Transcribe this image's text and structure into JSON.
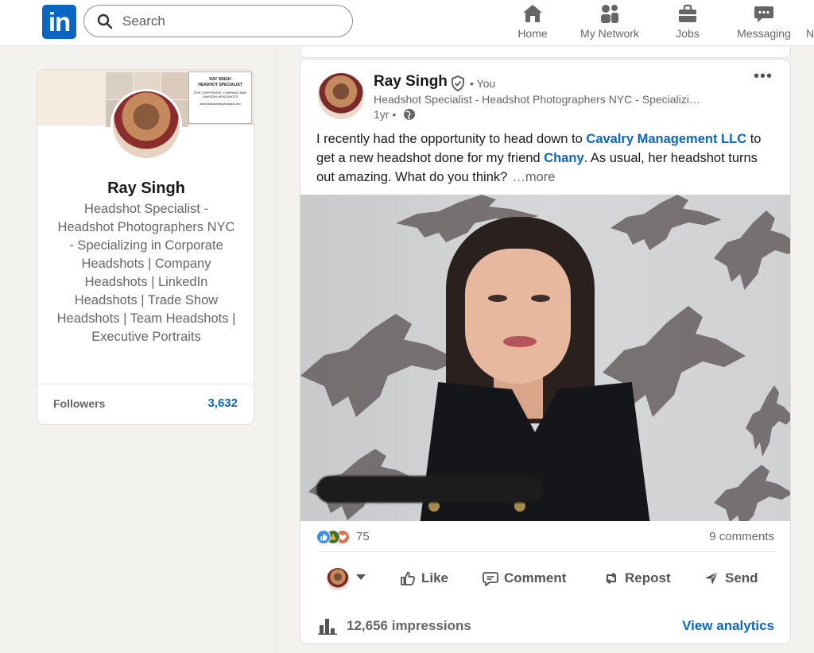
{
  "nav": {
    "logo": "in",
    "search_placeholder": "Search",
    "items": [
      {
        "label": "Home",
        "icon": "home-icon"
      },
      {
        "label": "My Network",
        "icon": "network-icon"
      },
      {
        "label": "Jobs",
        "icon": "briefcase-icon"
      },
      {
        "label": "Messaging",
        "icon": "messaging-icon"
      },
      {
        "label": "N",
        "icon": ""
      }
    ]
  },
  "profile": {
    "name": "Ray Singh",
    "headline": "Headshot Specialist - Headshot Photographers NYC - Specializing in Corporate Headshots | Company Headshots | LinkedIn Headshots | Trade Show Headshots | Team Headshots | Executive Portraits",
    "banner_card": {
      "line1": "RAY SINGH",
      "line2": "HEADHOT SPECIALIST",
      "line3": "FOR CORPORATE, COMPANY AND LINKEDIN HEADSHOTS",
      "line4": "www.headshotspecialist.com"
    },
    "followers_label": "Followers",
    "followers_count": "3,632"
  },
  "post": {
    "author": "Ray Singh",
    "you_label": "• You",
    "subtitle": "Headshot Specialist - Headshot Photographers NYC - Specializi…",
    "time": "1yr •",
    "text_before": "I recently had the opportunity to head down to ",
    "mention1": "Cavalry Management LLC",
    "text_middle": " to get a new headshot done for my friend ",
    "mention2": "Chany",
    "text_after": ". As usual, her headshot turns out amazing. What do you think?",
    "more": "…more",
    "reactions_count": "75",
    "comments": "9 comments",
    "actions": {
      "like": "Like",
      "comment": "Comment",
      "repost": "Repost",
      "send": "Send"
    },
    "impressions": "12,656 impressions",
    "analytics": "View analytics"
  },
  "colors": {
    "brand": "#0a66c2",
    "like": "#378fe9",
    "celebrate": "#44712e",
    "love": "#df704d"
  }
}
